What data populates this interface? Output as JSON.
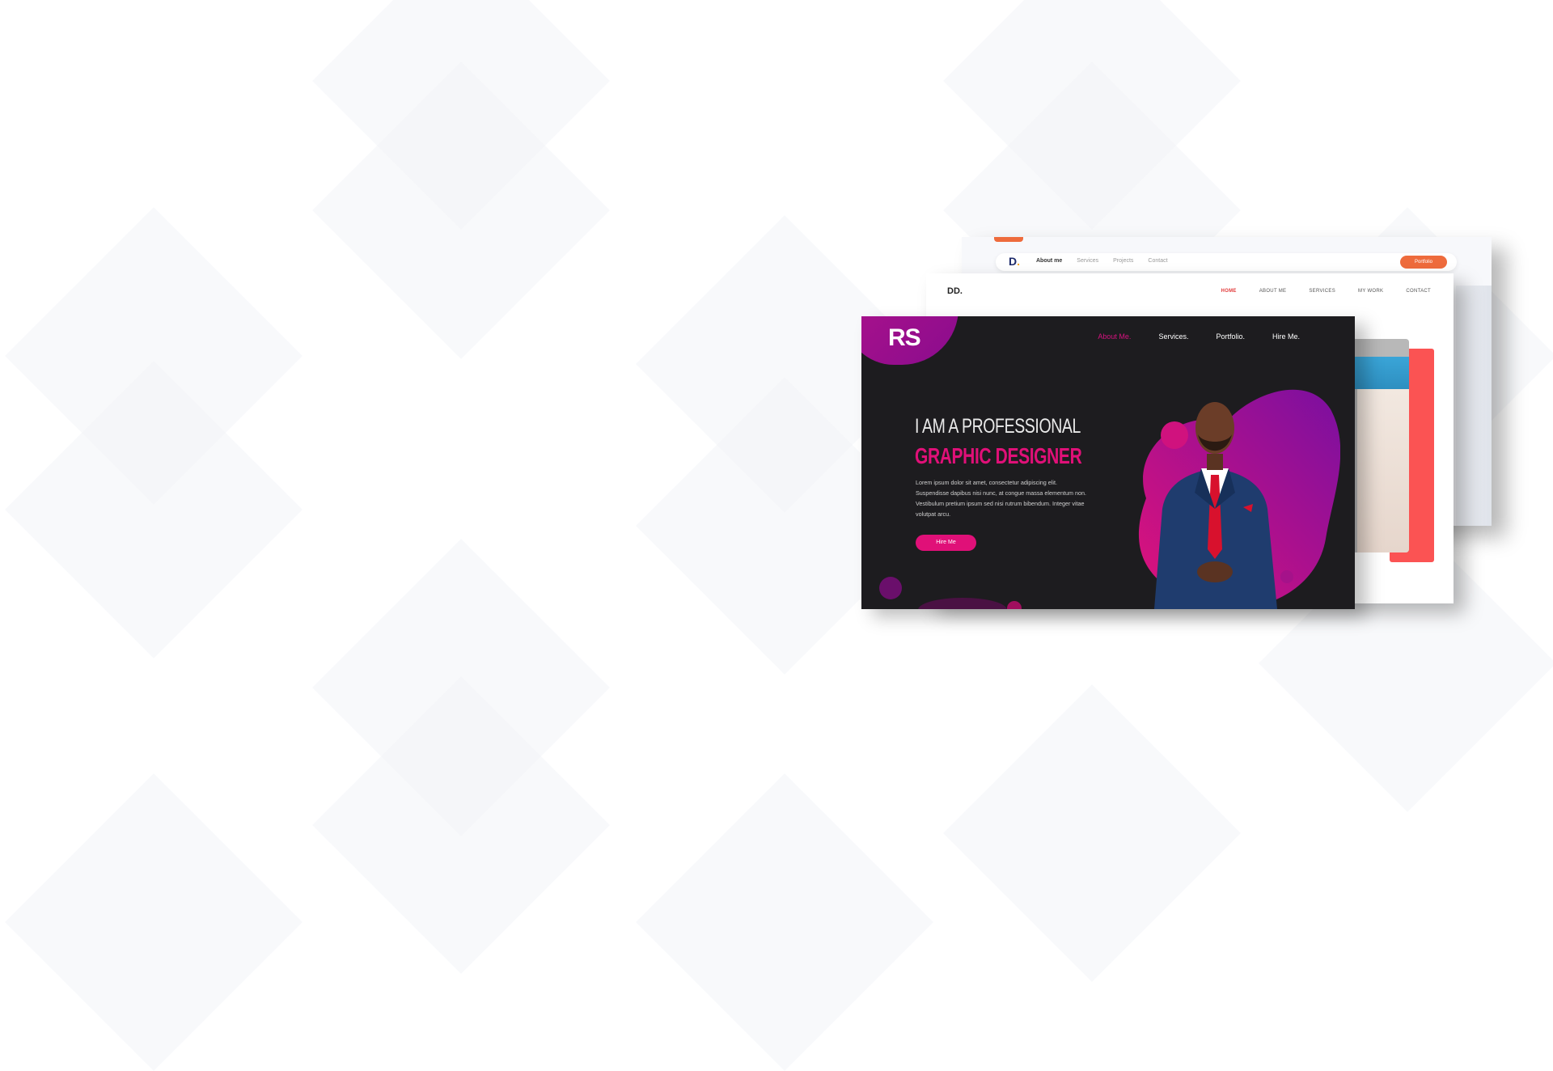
{
  "background": {
    "pattern_color": "#f3f4f8",
    "page_color": "#ffffff"
  },
  "mockup_back": {
    "logo_text": "D",
    "logo_dot": ".",
    "nav_links": [
      "About me",
      "Services",
      "Projects",
      "Contact"
    ],
    "cta_label": "Portfolio",
    "accent_color": "#ee6b3c"
  },
  "mockup_mid": {
    "logo": "DD.",
    "nav_links": [
      "HOME",
      "ABOUT ME",
      "SERVICES",
      "MY WORK",
      "CONTACT"
    ],
    "accent_color": "#fb5353"
  },
  "mockup_front": {
    "logo": "RS",
    "nav_links": [
      "About Me.",
      "Services.",
      "Portfolio.",
      "Hire Me."
    ],
    "headline_line1": "I AM A PROFESSIONAL",
    "headline_line2": "GRAPHIC DESIGNER",
    "body_text": "Lorem ipsum dolor sit amet, consectetur adipiscing elit. Suspendisse dapibus nisi nunc, at congue massa elementum non. Vestibulum pretium ipsum sed nisi rutrum bibendum. Integer vitae volutpat arcu.",
    "hire_button": "Hire Me",
    "accent_color": "#e01078",
    "dark_bg": "#1d1c1f"
  }
}
